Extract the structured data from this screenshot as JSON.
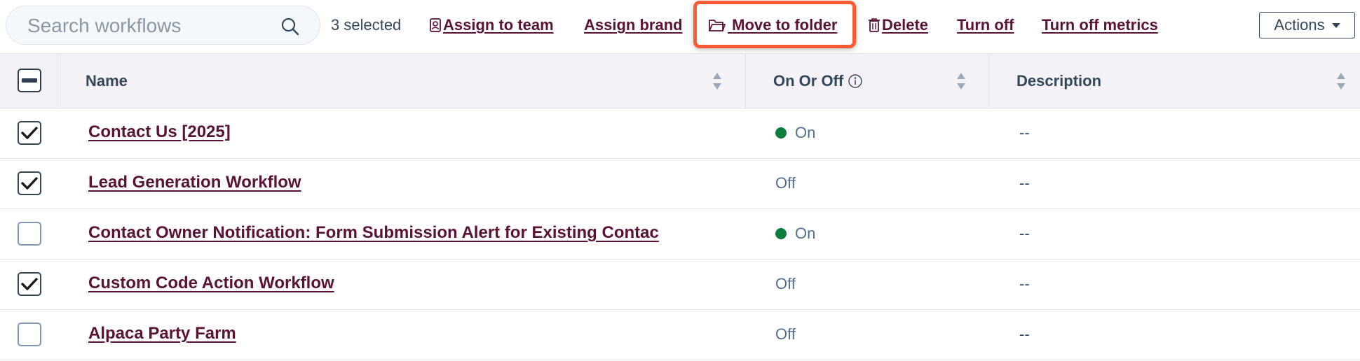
{
  "search": {
    "placeholder": "Search workflows",
    "icon": "search-icon"
  },
  "selection": {
    "count_label": "3 selected"
  },
  "bulk_actions": {
    "assign_team": "Assign to team",
    "assign_brand": "Assign brand",
    "move_folder": "Move to folder",
    "delete": "Delete",
    "turn_off": "Turn off",
    "turn_off_metrics": "Turn off metrics",
    "highlight_color": "#ff5c35"
  },
  "actions_menu": {
    "label": "Actions"
  },
  "table": {
    "columns": {
      "name": "Name",
      "status": "On Or Off",
      "description": "Description"
    },
    "rows": [
      {
        "name": "Contact Us [2025]",
        "checked": true,
        "status": "On",
        "status_on": true,
        "description": "--"
      },
      {
        "name": "Lead Generation Workflow",
        "checked": true,
        "status": "Off",
        "status_on": false,
        "description": "--"
      },
      {
        "name": "Contact Owner Notification: Form Submission Alert for Existing Contac",
        "checked": false,
        "status": "On",
        "status_on": true,
        "description": "--"
      },
      {
        "name": "Custom Code Action Workflow",
        "checked": true,
        "status": "Off",
        "status_on": false,
        "description": "--"
      },
      {
        "name": "Alpaca Party Farm",
        "checked": false,
        "status": "Off",
        "status_on": false,
        "description": "--"
      }
    ]
  },
  "colors": {
    "link": "#5b1237",
    "on_dot": "#0a7e3d",
    "header_bg": "#f4f2f6"
  }
}
